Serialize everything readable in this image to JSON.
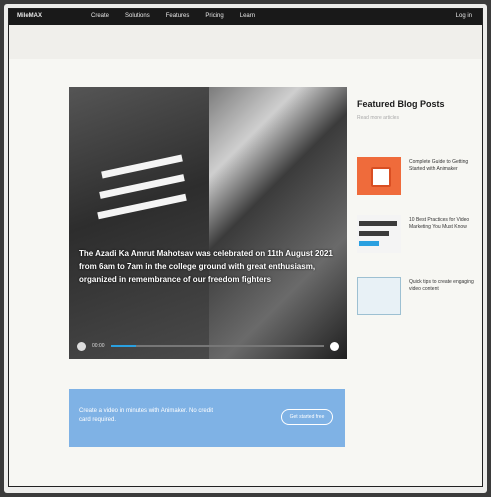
{
  "topbar": {
    "brand": "MileMAX",
    "nav": [
      "Create",
      "Solutions",
      "Features",
      "Pricing",
      "Learn"
    ],
    "login": "Log in"
  },
  "hero": {
    "caption": "The Azadi Ka Amrut Mahotsav was celebrated on 11th August 2021 from 6am to 7am in the college ground with great enthusiasm, organized in remembrance of our freedom fighters",
    "controls": {
      "time": "00:00",
      "progress": 0.12
    }
  },
  "sidebar": {
    "title": "Featured Blog Posts",
    "subtitle": "Read more articles",
    "posts": [
      {
        "title": "Complete Guide to Getting Started with Animaker"
      },
      {
        "title": "10 Best Practices for Video Marketing You Must Know"
      },
      {
        "title": "Quick tips to create engaging video content"
      }
    ]
  },
  "cta": {
    "text": "Create a video in minutes with Animaker. No credit card required.",
    "button": "Get started free"
  },
  "colors": {
    "topbar": "#191919",
    "accent_blue": "#7fb2e5",
    "thumb_orange": "#ef6b3b"
  }
}
